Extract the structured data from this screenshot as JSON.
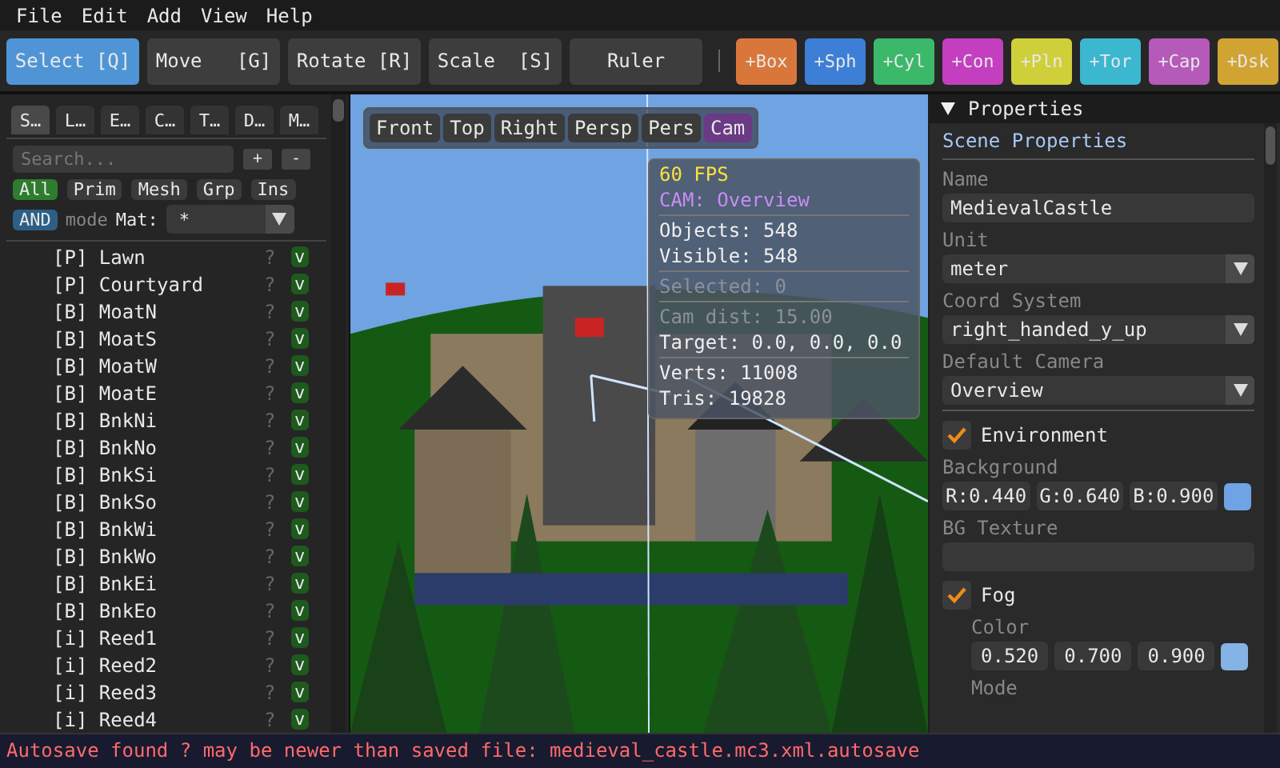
{
  "menu": [
    "File",
    "Edit",
    "Add",
    "View",
    "Help"
  ],
  "tools": [
    {
      "label": "Select [Q]",
      "selected": true
    },
    {
      "label": "Move   [G]",
      "selected": false
    },
    {
      "label": "Rotate [R]",
      "selected": false
    },
    {
      "label": "Scale  [S]",
      "selected": false
    },
    {
      "label": "Ruler",
      "selected": false
    }
  ],
  "add_buttons": [
    {
      "label": "+Box",
      "color": "#d9773a"
    },
    {
      "label": "+Sph",
      "color": "#3d7fd6"
    },
    {
      "label": "+Cyl",
      "color": "#3bb86a"
    },
    {
      "label": "+Con",
      "color": "#c43fbf"
    },
    {
      "label": "+Pln",
      "color": "#cfcf3a"
    },
    {
      "label": "+Tor",
      "color": "#3bb7cf"
    },
    {
      "label": "+Cap",
      "color": "#b65ab9"
    },
    {
      "label": "+Dsk",
      "color": "#d1a332"
    }
  ],
  "left_tabs": [
    {
      "label": "S…",
      "selected": true
    },
    {
      "label": "L…",
      "selected": false
    },
    {
      "label": "E…",
      "selected": false
    },
    {
      "label": "C…",
      "selected": false
    },
    {
      "label": "T…",
      "selected": false
    },
    {
      "label": "D…",
      "selected": false
    },
    {
      "label": "M…",
      "selected": false
    }
  ],
  "search": {
    "placeholder": "Search...",
    "add": "+",
    "remove": "-"
  },
  "filters": [
    {
      "label": "All",
      "selected": true
    },
    {
      "label": "Prim",
      "selected": false
    },
    {
      "label": "Mesh",
      "selected": false
    },
    {
      "label": "Grp",
      "selected": false
    },
    {
      "label": "Ins",
      "selected": false
    }
  ],
  "mode": {
    "button": "AND",
    "label": "mode",
    "mat_label": "Mat:",
    "mat_value": "*"
  },
  "objects": [
    {
      "label": "[P] Lawn",
      "flag": "?",
      "vis": "v"
    },
    {
      "label": "[P] Courtyard",
      "flag": "?",
      "vis": "v"
    },
    {
      "label": "[B] MoatN",
      "flag": "?",
      "vis": "v"
    },
    {
      "label": "[B] MoatS",
      "flag": "?",
      "vis": "v"
    },
    {
      "label": "[B] MoatW",
      "flag": "?",
      "vis": "v"
    },
    {
      "label": "[B] MoatE",
      "flag": "?",
      "vis": "v"
    },
    {
      "label": "[B] BnkNi",
      "flag": "?",
      "vis": "v"
    },
    {
      "label": "[B] BnkNo",
      "flag": "?",
      "vis": "v"
    },
    {
      "label": "[B] BnkSi",
      "flag": "?",
      "vis": "v"
    },
    {
      "label": "[B] BnkSo",
      "flag": "?",
      "vis": "v"
    },
    {
      "label": "[B] BnkWi",
      "flag": "?",
      "vis": "v"
    },
    {
      "label": "[B] BnkWo",
      "flag": "?",
      "vis": "v"
    },
    {
      "label": "[B] BnkEi",
      "flag": "?",
      "vis": "v"
    },
    {
      "label": "[B] BnkEo",
      "flag": "?",
      "vis": "v"
    },
    {
      "label": "[i] Reed1",
      "flag": "?",
      "vis": "v"
    },
    {
      "label": "[i] Reed2",
      "flag": "?",
      "vis": "v"
    },
    {
      "label": "[i] Reed3",
      "flag": "?",
      "vis": "v"
    },
    {
      "label": "[i] Reed4",
      "flag": "?",
      "vis": "v"
    }
  ],
  "view_buttons": [
    {
      "label": "Front",
      "selected": false
    },
    {
      "label": "Top",
      "selected": false
    },
    {
      "label": "Right",
      "selected": false
    },
    {
      "label": "Persp",
      "selected": false
    },
    {
      "label": "Pers",
      "selected": false
    },
    {
      "label": "Cam",
      "selected": true
    }
  ],
  "stats": {
    "fps": "60 FPS",
    "sections": [
      [
        {
          "text": "CAM: Overview",
          "kind": "cam"
        }
      ],
      [
        {
          "text": "Objects: 548",
          "kind": "normal"
        },
        {
          "text": "Visible: 548",
          "kind": "normal"
        }
      ],
      [
        {
          "text": "Selected: 0",
          "kind": "dim"
        }
      ],
      [
        {
          "text": "Cam dist: 15.00",
          "kind": "dim"
        },
        {
          "text": "Target: 0.0, 0.0, 0.0",
          "kind": "normal"
        }
      ],
      [
        {
          "text": "Verts: 11008",
          "kind": "normal"
        },
        {
          "text": "Tris: 19828",
          "kind": "normal"
        }
      ]
    ]
  },
  "properties": {
    "header": "Properties",
    "section": "Scene Properties",
    "fields": [
      {
        "label": "Name",
        "value": "MedievalCastle",
        "kind": "text"
      },
      {
        "label": "Unit",
        "value": "meter",
        "kind": "combo"
      },
      {
        "label": "Coord System",
        "value": "right_handed_y_up",
        "kind": "combo"
      },
      {
        "label": "Default Camera",
        "value": "Overview",
        "kind": "combo"
      }
    ],
    "environment": {
      "label": "Environment",
      "checked": true,
      "background_label": "Background",
      "background": [
        "R:0.440",
        "G:0.640",
        "B:0.900"
      ],
      "texture_label": "BG Texture"
    },
    "fog": {
      "label": "Fog",
      "checked": true,
      "color_label": "Color",
      "color_values": [
        "0.520",
        "0.700",
        "0.900"
      ],
      "mode_label": "Mode"
    }
  },
  "status": "Autosave found ? may be newer than saved file: medieval_castle.mc3.xml.autosave"
}
